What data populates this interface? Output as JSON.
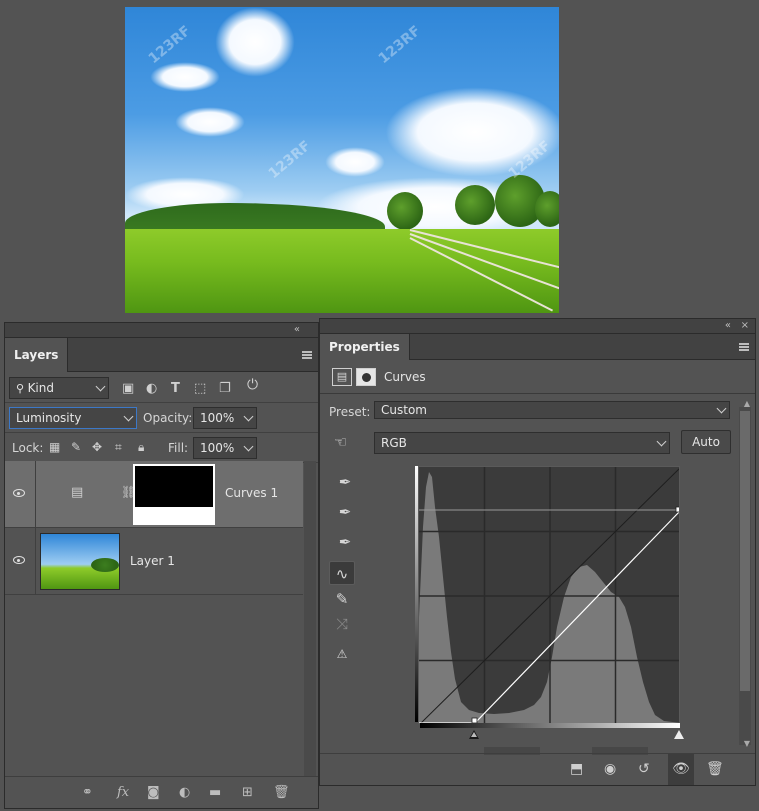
{
  "layers_panel": {
    "tab_label": "Layers",
    "filter": {
      "kind_value": "Kind"
    },
    "blend_mode": "Luminosity",
    "opacity_label": "Opacity:",
    "opacity_value": "100%",
    "lock_label": "Lock:",
    "fill_label": "Fill:",
    "fill_value": "100%",
    "layers": [
      {
        "name": "Curves 1",
        "selected": true,
        "type": "adjustment"
      },
      {
        "name": "Layer 1",
        "selected": false,
        "type": "pixel"
      }
    ]
  },
  "properties_panel": {
    "tab_label": "Properties",
    "adjustment_name": "Curves",
    "preset_label": "Preset:",
    "preset_value": "Custom",
    "channel_value": "RGB",
    "auto_label": "Auto",
    "curve": {
      "input_black_point": 0.2,
      "output_white_point": 0.84
    }
  },
  "photo": {
    "watermark": "123RF"
  },
  "colors": {
    "panel_bg": "#535353",
    "panel_dark": "#424242",
    "selected_layer": "#6e6e6e",
    "graph_bg": "#3b3b3b",
    "histogram": "#7a7a7a"
  }
}
